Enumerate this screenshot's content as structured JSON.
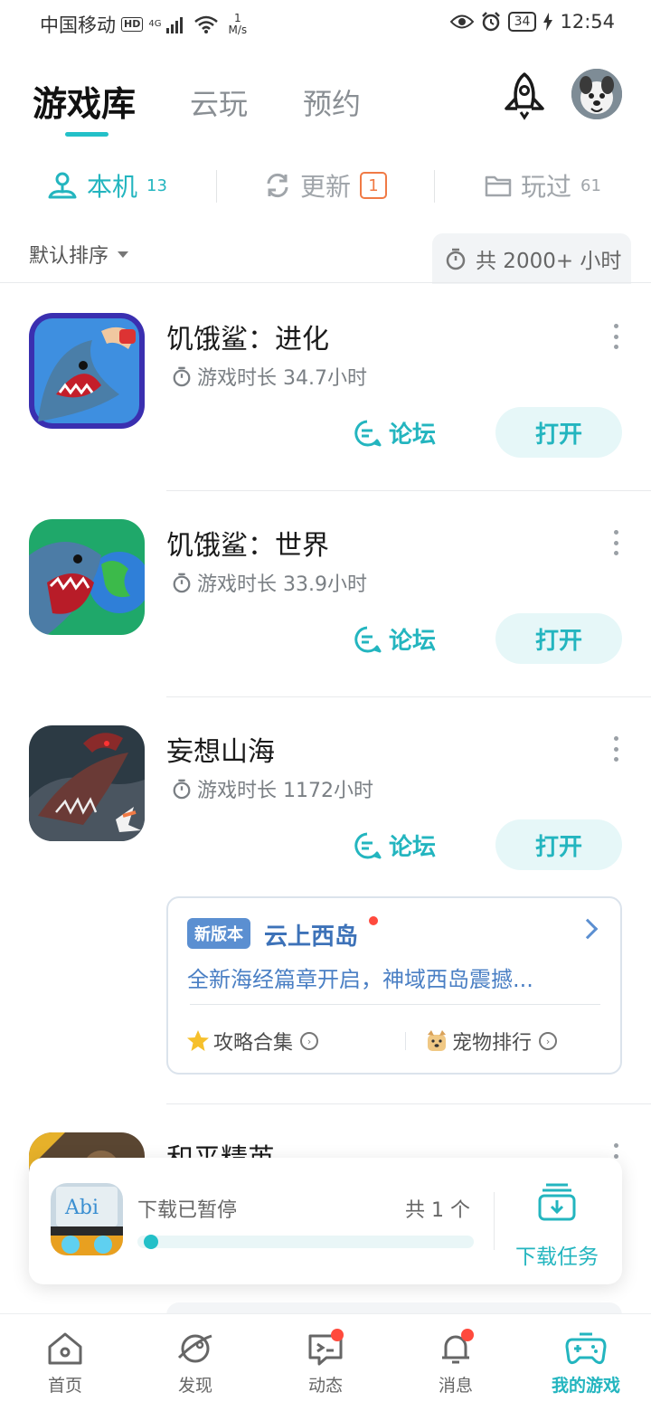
{
  "status_bar": {
    "carrier": "中国移动",
    "hd": "HD",
    "network": "4G",
    "speed_value": "1",
    "speed_unit": "M/s",
    "battery": "34",
    "time": "12:54"
  },
  "header": {
    "tabs": [
      {
        "label": "游戏库",
        "active": true
      },
      {
        "label": "云玩",
        "active": false
      },
      {
        "label": "预约",
        "active": false
      }
    ],
    "rocket_icon": "rocket-icon",
    "avatar_icon": "avatar"
  },
  "subtabs": {
    "local": {
      "label": "本机",
      "count": "13"
    },
    "update": {
      "label": "更新",
      "count": "1"
    },
    "played": {
      "label": "玩过",
      "count": "61"
    }
  },
  "sort": {
    "label": "默认排序",
    "total_hours": "共 2000+ 小时"
  },
  "games": [
    {
      "title": "饥饿鲨：进化",
      "time": "游戏时长 34.7小时",
      "forum": "论坛",
      "open": "打开"
    },
    {
      "title": "饥饿鲨：世界",
      "time": "游戏时长 33.9小时",
      "forum": "论坛",
      "open": "打开"
    },
    {
      "title": "妄想山海",
      "time": "游戏时长 1172小时",
      "forum": "论坛",
      "open": "打开"
    },
    {
      "title": "和平精英"
    }
  ],
  "news_card": {
    "badge": "新版本",
    "title": "云上西岛",
    "desc": "全新海经篇章开启，神域西岛震撼...",
    "link1": "攻略合集",
    "link2": "宠物排行"
  },
  "download": {
    "status": "下载已暂停",
    "count": "共 1 个",
    "progress": 0.02,
    "task_label": "下载任务",
    "app_icon_text": "Abi"
  },
  "bottom_nav": [
    {
      "label": "首页",
      "icon": "home-icon"
    },
    {
      "label": "发现",
      "icon": "planet-icon"
    },
    {
      "label": "动态",
      "icon": "chat-icon",
      "dot": true
    },
    {
      "label": "消息",
      "icon": "bell-icon",
      "dot": true
    },
    {
      "label": "我的游戏",
      "icon": "gamepad-icon",
      "active": true
    }
  ],
  "colors": {
    "accent": "#23b5bf",
    "badge_orange": "#f07a45",
    "news_blue": "#3d72b8",
    "red_dot": "#ff4a3d"
  }
}
